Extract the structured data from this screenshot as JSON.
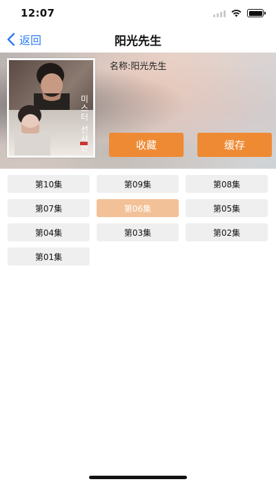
{
  "status_bar": {
    "time": "12:07"
  },
  "nav": {
    "back_label": "返回",
    "title": "阳光先生"
  },
  "detail": {
    "name_line": "名称:阳光先生",
    "poster_text": "미스터 선샤인",
    "favorite_label": "收藏",
    "cache_label": "缓存"
  },
  "episodes": {
    "items": [
      {
        "label": "第10集"
      },
      {
        "label": "第09集"
      },
      {
        "label": "第08集"
      },
      {
        "label": "第07集"
      },
      {
        "label": "第06集",
        "selected": true
      },
      {
        "label": "第05集"
      },
      {
        "label": "第04集"
      },
      {
        "label": "第03集"
      },
      {
        "label": "第02集"
      },
      {
        "label": "第01集"
      }
    ]
  },
  "colors": {
    "accent_orange": "#ee8a33",
    "selected_episode_bg": "#f3c197",
    "episode_bg": "#efefef",
    "back_blue": "#2f7cf6"
  },
  "icons": {
    "back": "chevron-left-icon",
    "wifi": "wifi-icon",
    "signal": "cellular-signal-icon",
    "battery": "battery-icon"
  }
}
